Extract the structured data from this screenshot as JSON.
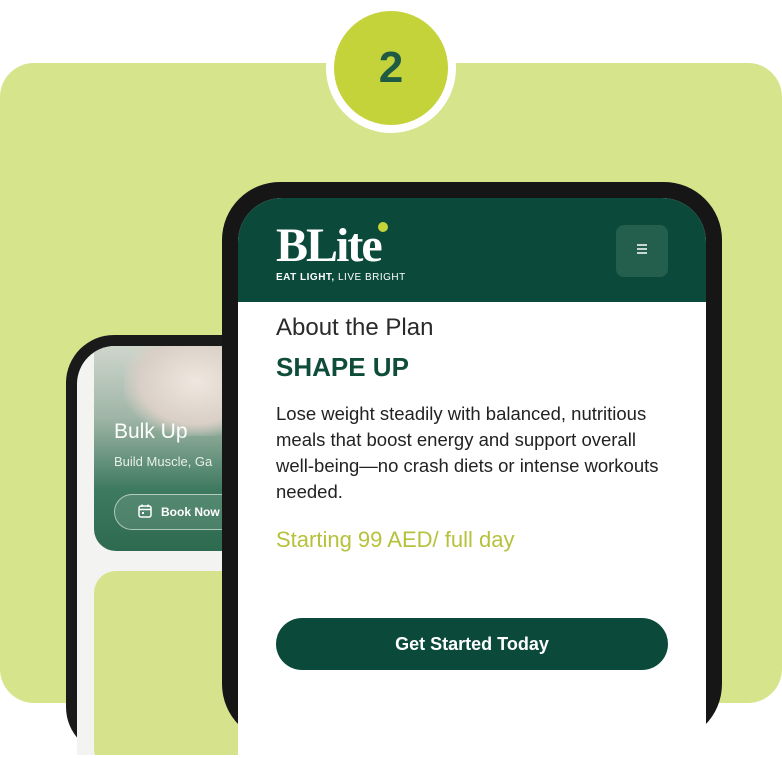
{
  "step": {
    "number": "2"
  },
  "back_phone": {
    "title": "Bulk Up",
    "subtitle": "Build Muscle, Ga",
    "book_label": "Book Now"
  },
  "app": {
    "logo": "BLite",
    "tagline_bold": "EAT LIGHT,",
    "tagline_rest": " LIVE BRIGHT",
    "about_heading": "About the Plan",
    "plan_name": "SHAPE UP",
    "description": "Lose weight steadily with balanced, nutritious meals that boost energy and support overall well-being—no crash diets or intense workouts needed.",
    "price": "Starting 99 AED/ full day",
    "cta_label": "Get Started Today"
  },
  "icons": [
    "menu-icon",
    "calendar-icon"
  ],
  "colors": {
    "background": "#d6e58c",
    "badge": "#c5d33a",
    "primary_green": "#0b4a3a",
    "price_yellow": "#b6c13c"
  }
}
